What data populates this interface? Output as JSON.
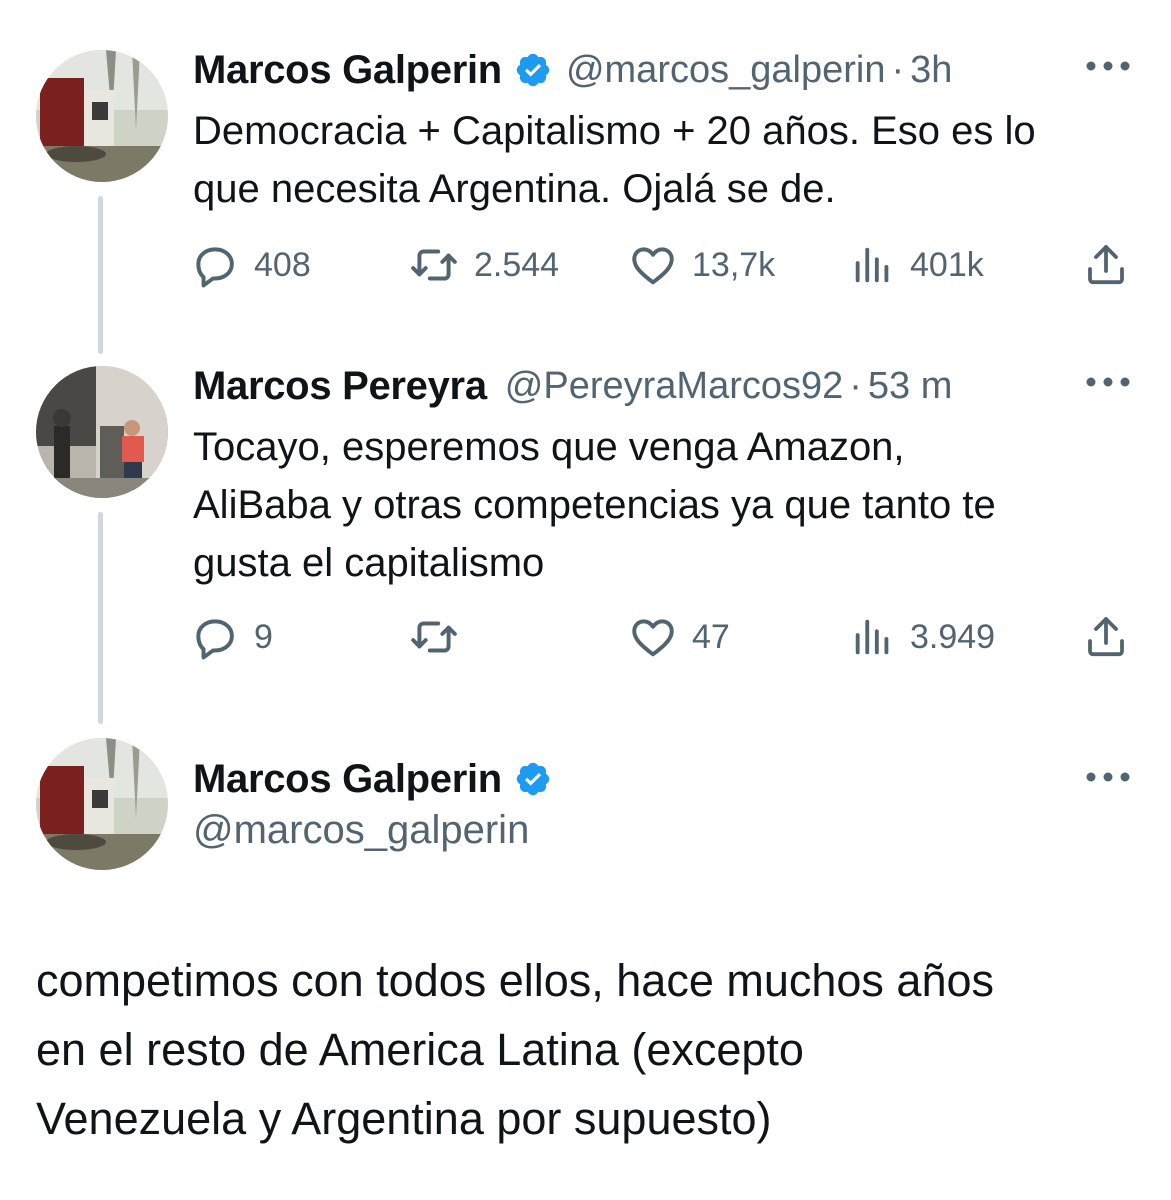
{
  "tweets": [
    {
      "name": "Marcos Galperin",
      "verified": true,
      "handle": "@marcos_galperin",
      "dot": "·",
      "time": "3h",
      "lines": [
        "Democracia + Capitalismo + 20 años. Eso es lo",
        "que necesita Argentina. Ojalá se de."
      ],
      "replies": "408",
      "retweets": "2.544",
      "likes": "13,7k",
      "views": "401k"
    },
    {
      "name": "Marcos Pereyra",
      "verified": false,
      "handle": "@PereyraMarcos92",
      "dot": "·",
      "time": "53 m",
      "lines": [
        "Tocayo, esperemos que venga Amazon,",
        "AliBaba y otras competencias ya que tanto te",
        "gusta el capitalismo"
      ],
      "replies": "9",
      "retweets": "",
      "likes": "47",
      "views": "3.949"
    }
  ],
  "focus_tweet": {
    "name": "Marcos Galperin",
    "verified": true,
    "handle": "@marcos_galperin",
    "lines": [
      "competimos con todos ellos, hace muchos años",
      "en el resto de America Latina (excepto",
      "Venezuela y Argentina por supuesto)"
    ]
  },
  "colors": {
    "text": "#0f1419",
    "secondary": "#536471",
    "verified": "#1d9bf0",
    "thread_line": "#cfd9de"
  },
  "icons": [
    "reply-icon",
    "retweet-icon",
    "like-icon",
    "views-icon",
    "share-icon",
    "verified-icon",
    "more-icon"
  ]
}
